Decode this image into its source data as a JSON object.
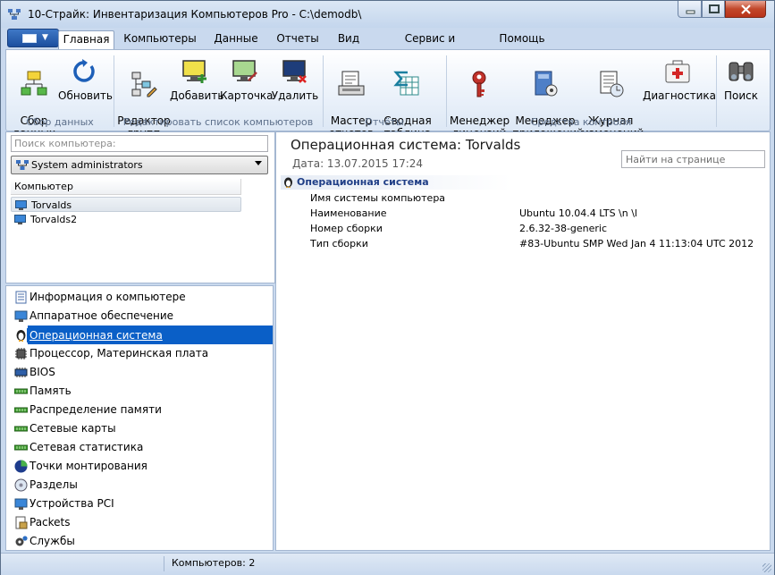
{
  "window": {
    "title": "10-Страйк: Инвентаризация Компьютеров Pro - C:\\demodb\\"
  },
  "tabs": [
    "Главная",
    "Компьютеры",
    "Данные",
    "Отчеты",
    "Вид",
    "Сервис и настройки",
    "Помощь"
  ],
  "ribbon": {
    "collect": {
      "label": "Сбор\nданных"
    },
    "refresh": {
      "label": "Обновить"
    },
    "group_editor": {
      "label": "Редактор\nгрупп"
    },
    "add": {
      "label": "Добавить"
    },
    "card": {
      "label": "Карточка"
    },
    "delete": {
      "label": "Удалить"
    },
    "report_wizard": {
      "label": "Мастер\nотчетов"
    },
    "pivot": {
      "label": "Сводная\nтаблица"
    },
    "license_mgr": {
      "label": "Менеджер\nлицензий"
    },
    "app_mgr": {
      "label": "Менеджер\nприложений"
    },
    "change_log": {
      "label": "Журнал\nизменений"
    },
    "diagnostics": {
      "label": "Диагностика"
    },
    "search": {
      "label": "Поиск"
    },
    "groups": [
      "Сбор данных",
      "Редактировать список компьютеров",
      "Отчёты",
      "Средства контроля"
    ]
  },
  "left": {
    "search_placeholder": "Поиск компьютера:",
    "group": "System administrators",
    "column_header": "Компьютер",
    "computers": [
      "Torvalds",
      "Torvalds2"
    ]
  },
  "categories": [
    "Информация о компьютере",
    "Аппаратное обеспечение",
    "Операционная система",
    "Процессор, Материнская плата",
    "BIOS",
    "Память",
    "Распределение памяти",
    "Сетевые карты",
    "Сетевая статистика",
    "Точки монтирования",
    "Разделы",
    "Устройства PCI",
    "Packets",
    "Службы"
  ],
  "detail": {
    "title": "Операционная система: Torvalds",
    "date": "Дата: 13.07.2015 17:24",
    "page_search": "Найти на странице",
    "section": "Операционная система",
    "props": [
      {
        "name": "Имя системы компьютера",
        "value": ""
      },
      {
        "name": "Наименование",
        "value": "Ubuntu 10.04.4 LTS \\n \\l"
      },
      {
        "name": "Номер сборки",
        "value": "2.6.32-38-generic"
      },
      {
        "name": "Тип сборки",
        "value": "#83-Ubuntu SMP Wed Jan 4 11:13:04 UTC 2012"
      }
    ]
  },
  "status": {
    "count": "Компьютеров: 2"
  }
}
